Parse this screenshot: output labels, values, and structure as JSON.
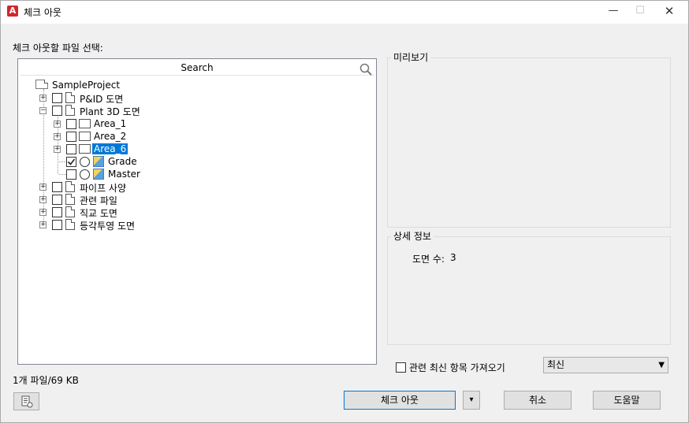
{
  "window": {
    "title": "체크 아웃",
    "app_icon_letter": "A",
    "minimize_glyph": "—",
    "maximize_glyph": "☐",
    "close_glyph": "✕"
  },
  "left": {
    "select_label": "체크 아웃할 파일 선택:",
    "search_placeholder": "Search",
    "tree": {
      "root": "SampleProject",
      "pid": "P&ID 도면",
      "plant3d": "Plant 3D 도면",
      "area1": "Area_1",
      "area2": "Area_2",
      "area6": "Area_6",
      "grade": "Grade",
      "master": "Master",
      "pipe_spec": "파이프 사양",
      "related_files": "관련 파일",
      "ortho": "직교 도면",
      "iso": "등각투영 도면"
    },
    "status": "1개  파일/69 KB"
  },
  "preview": {
    "title": "미리보기"
  },
  "details": {
    "title": "상세 정보",
    "drawing_count_label": "도면 수:",
    "drawing_count": "3"
  },
  "options": {
    "get_latest_label": "관련 최신 항목 가져오기",
    "get_latest_checked": false,
    "version_select": "최신"
  },
  "buttons": {
    "checkout": "체크 아웃",
    "dropdown": "▾",
    "cancel": "취소",
    "help": "도움말"
  }
}
